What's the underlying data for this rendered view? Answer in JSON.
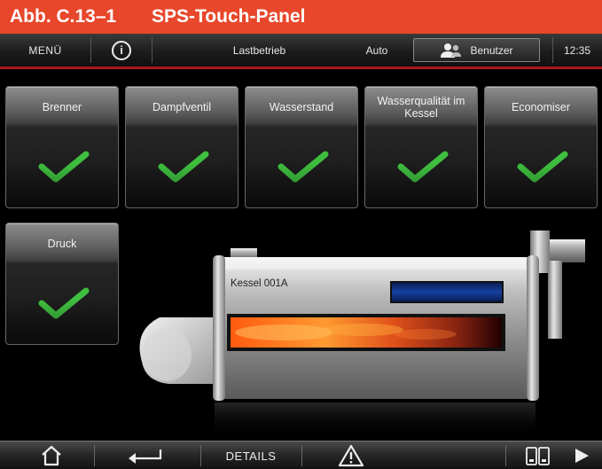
{
  "caption": {
    "figure": "Abb. C.13–1",
    "title": "SPS-Touch-Panel"
  },
  "topbar": {
    "menu_label": "MENÜ",
    "info_icon_text": "i",
    "mode_label": "Lastbetrieb",
    "auto_label": "Auto",
    "user_button_label": "Benutzer",
    "time": "12:35"
  },
  "tiles": [
    {
      "label": "Brenner",
      "status": "ok"
    },
    {
      "label": "Dampfventil",
      "status": "ok"
    },
    {
      "label": "Wasserstand",
      "status": "ok"
    },
    {
      "label": "Wasserqualität im Kessel",
      "status": "ok"
    },
    {
      "label": "Economiser",
      "status": "ok"
    },
    {
      "label": "Druck",
      "status": "ok"
    }
  ],
  "boiler": {
    "label": "Kessel 001A"
  },
  "bottombar": {
    "details_label": "DETAILS"
  },
  "colors": {
    "banner": "#e8472b",
    "accent_line": "#b01818",
    "check": "#3fbf3f",
    "level_bar": "#1640a0"
  }
}
